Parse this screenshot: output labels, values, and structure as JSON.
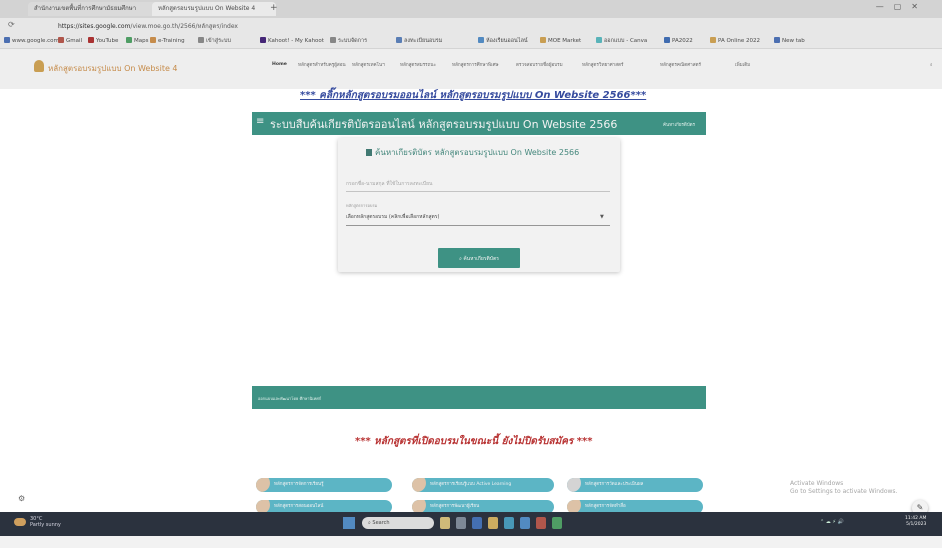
{
  "browser": {
    "tabs": [
      {
        "label": "สำนักงานเขตพื้นที่การศึกษามัธยมศึกษา"
      },
      {
        "label": "หลักสูตรอบรมรูปแบบ On Website 4"
      }
    ],
    "url_domain": "https://sites.google.com",
    "url_path": "/view.moe.go.th/2566/หลักสูตร/index",
    "bookmarks": [
      "www.google.com",
      "Gmail",
      "YouTube",
      "Maps",
      "e-Training",
      "เข้าสู่ระบบ",
      "Kahoot! - My Kahoot",
      "ระบบจัดการ",
      "ลงทะเบียนอบรม",
      "ห้องเรียนออนไลน์",
      "MOE Market",
      "ออกแบบ - Canva",
      "PA2022",
      "PA Online 2022",
      "New tab"
    ]
  },
  "site": {
    "title": "หลักสูตรอบรมรูปแบบ On Website 4",
    "nav": [
      "Home",
      "หลักสูตรสำหรับครูผู้สอน",
      "หลักสูตรเทคโนฯ",
      "หลักสูตรสมรรถนะ",
      "หลักสูตรการศึกษาพิเศษ",
      "ตรวจสอบรายชื่อผู้อบรม",
      "หลักสูตรวิทยาศาสตร์",
      "หลักสูตรคณิตศาสตร์",
      "เพิ่มเติม"
    ]
  },
  "content": {
    "link_heading": "*** คลิ๊กหลักสูตรอบรมออนไลน์ หลักสูตรอบรมรูปแบบ On Website 2566***",
    "banner_title": "ระบบสืบค้นเกียรติบัตรออนไลน์ หลักสูตรอบรมรูปแบบ On Website 2566",
    "banner_right": "ค้นหาเกียรติบัตร",
    "card_heading": "ค้นหาเกียรติบัตร หลักสูตรอบรมรูปแบบ On Website 2566",
    "field1_placeholder": "กรอกชื่อ-นามสกุล ที่ใช้ในการลงทะเบียน",
    "field2_label": "หลักสูตรการอบรม",
    "field2_value": "เลือกหลักสูตรอบรม (คลิกเพื่อเลือกหลักสูตร)",
    "search_button": "ค้นหาเกียรติบัตร",
    "footer_text": "ออกแบบและพัฒนาโดย ศึกษานิเทศก์",
    "courses_title": "*** หลักสูตรที่เปิดอบรมในขณะนี้ ยังไม่ปิดรับสมัคร ***",
    "course_pills": [
      "หลักสูตรการจัดการเรียนรู้",
      "หลักสูตรการเรียนรู้แบบ Active Learning",
      "หลักสูตรการวัดและประเมินผล",
      "หลักสูตรการสอนออนไลน์",
      "หลักสูตรการพัฒนาผู้เรียน",
      "หลักสูตรการจัดทำสื่อ"
    ]
  },
  "overlay": {
    "windows_activate_line1": "Activate Windows",
    "windows_activate_line2": "Go to Settings to activate Windows."
  },
  "taskbar": {
    "weather_temp": "30°C",
    "weather_desc": "Partly sunny",
    "search_placeholder": "Search",
    "time": "11:42 AM",
    "date": "5/1/2023"
  }
}
